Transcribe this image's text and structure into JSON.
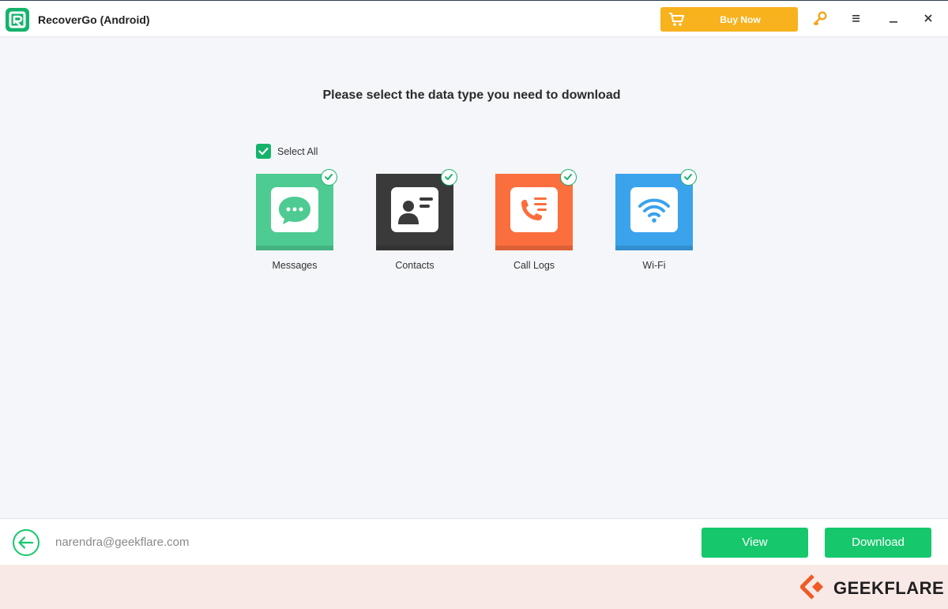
{
  "app": {
    "title": "RecoverGo (Android)",
    "buy_label": "Buy Now"
  },
  "main": {
    "heading": "Please select the data type you need to download",
    "select_all_label": "Select All",
    "select_all_checked": true,
    "types": [
      {
        "label": "Messages",
        "icon": "chat-bubble-icon",
        "color": "#4ecb92",
        "checked": true
      },
      {
        "label": "Contacts",
        "icon": "contact-card-icon",
        "color": "#3a3a3a",
        "checked": true
      },
      {
        "label": "Call Logs",
        "icon": "phone-list-icon",
        "color": "#fb6e3d",
        "checked": true
      },
      {
        "label": "Wi-Fi",
        "icon": "wifi-icon",
        "color": "#3aa3ec",
        "checked": true
      }
    ]
  },
  "footer": {
    "account": "narendra@geekflare.com",
    "view_label": "View",
    "download_label": "Download"
  },
  "watermark": {
    "text": "GEEKFLARE"
  },
  "colors": {
    "accent_green": "#16c76c",
    "buy_orange": "#f7b21e"
  }
}
